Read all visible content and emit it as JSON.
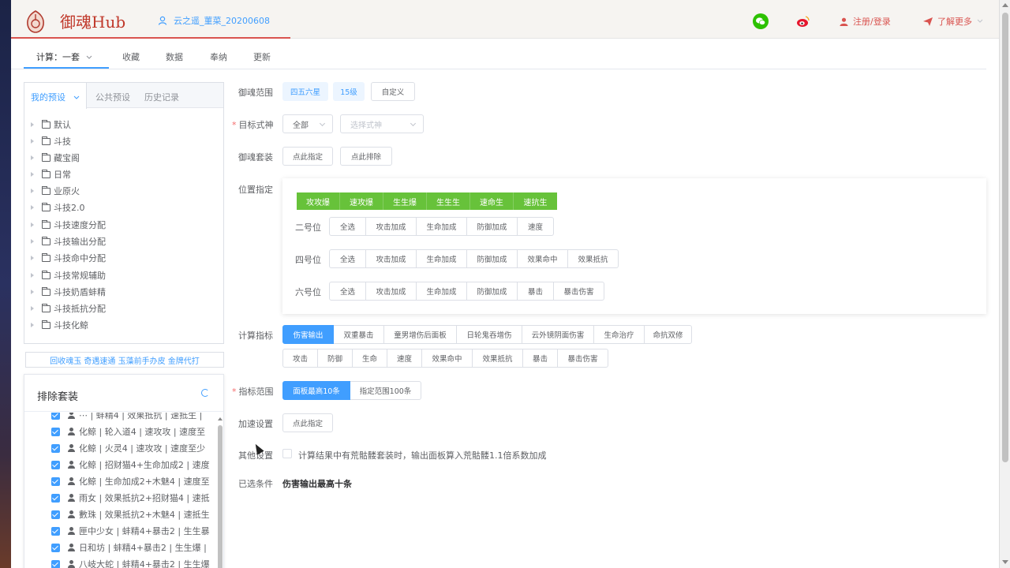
{
  "header": {
    "logo": "御魂Hub",
    "user": "云之遥_菫菜_20200608",
    "register": "注册/登录",
    "learn_more": "了解更多"
  },
  "tabs": [
    "计算：一套",
    "收藏",
    "数据",
    "奉纳",
    "更新"
  ],
  "presets": {
    "tabs": [
      "我的预设",
      "公共预设",
      "历史记录"
    ],
    "items": [
      "默认",
      "斗技",
      "藏宝阁",
      "日常",
      "业原火",
      "斗技2.0",
      "斗技速度分配",
      "斗技输出分配",
      "斗技命中分配",
      "斗技常规辅助",
      "斗技奶盾蚌精",
      "斗技抵抗分配",
      "斗技化鲸"
    ]
  },
  "promo": "回收魂玉 奇遇速通 玉藻前手办皮 金牌代打",
  "exclude": {
    "title": "排除套装",
    "items": [
      "⋯ | 蚌精4 | 效果抵抗 | 速抵生 |",
      "化鲸 | 轮入道4 | 速攻攻 | 速度至",
      "化鲸 | 火灵4 | 速攻攻 | 速度至少",
      "化鲸 | 招财猫4+生命加成2 | 速度",
      "化鲸 | 生命加成2+木魅4 | 速度至",
      "雨女 | 效果抵抗2+招财猫4 | 速抵",
      "數珠 | 效果抵抗2+木魅4 | 速抵生",
      "匣中少女 | 蚌精4+暴击2 | 生生暴",
      "日和坊 | 蚌精4+暴击2 | 生生爆 |",
      "八岐大蛇 | 蚌精4+暴击2 | 生生爆"
    ]
  },
  "form": {
    "scope_label": "御魂范围",
    "scope_opts": [
      "四五六星",
      "15级",
      "自定义"
    ],
    "target_label": "目标式神",
    "target_value": "全部",
    "target_placeholder": "选择式神",
    "suit_label": "御魂套装",
    "suit_btns": [
      "点此指定",
      "点此排除"
    ],
    "position_label": "位置指定",
    "pos_tags": [
      "攻攻爆",
      "速攻爆",
      "生生爆",
      "生生生",
      "速命生",
      "速抗生"
    ],
    "row2_label": "二号位",
    "row2": [
      "全选",
      "攻击加成",
      "生命加成",
      "防御加成",
      "速度"
    ],
    "row4_label": "四号位",
    "row4": [
      "全选",
      "攻击加成",
      "生命加成",
      "防御加成",
      "效果命中",
      "效果抵抗"
    ],
    "row6_label": "六号位",
    "row6": [
      "全选",
      "攻击加成",
      "生命加成",
      "防御加成",
      "暴击",
      "暴击伤害"
    ],
    "metric_label": "计算指标",
    "metrics1": [
      "伤害输出",
      "双重暴击",
      "童男增伤后面板",
      "日轮鬼吞增伤",
      "云外镜阴面伤害",
      "生命治疗",
      "命抗双修"
    ],
    "metrics2": [
      "攻击",
      "防御",
      "生命",
      "速度",
      "效果命中",
      "效果抵抗",
      "暴击",
      "暴击伤害"
    ],
    "range_label": "指标范围",
    "range_opts": [
      "面板最高10条",
      "指定范围100条"
    ],
    "speed_label": "加速设置",
    "speed_btn": "点此指定",
    "other_label": "其他设置",
    "other_text": "计算结果中有荒骷髅套装时，输出面板算入荒骷髅1.1倍系数加成",
    "selected_label": "已选条件",
    "selected_value": "伤害输出最高十条"
  }
}
